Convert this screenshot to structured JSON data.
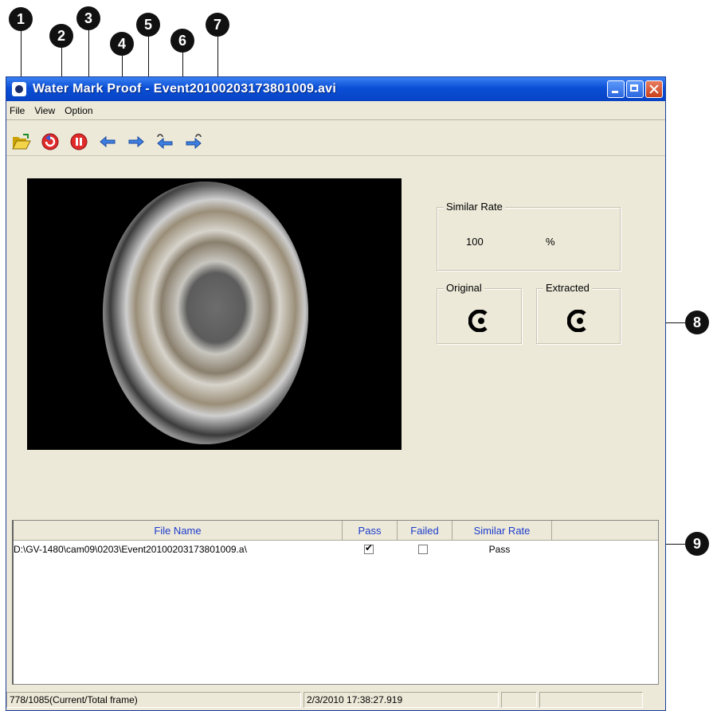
{
  "callouts": [
    "1",
    "2",
    "3",
    "4",
    "5",
    "6",
    "7",
    "8",
    "9"
  ],
  "window": {
    "title": "Water Mark Proof - Event20100203173801009.avi"
  },
  "menu": [
    "File",
    "View",
    "Option"
  ],
  "toolbar": {
    "icons": [
      "open-folder-icon",
      "rewind-icon",
      "pause-icon",
      "prev-frame-icon",
      "next-frame-icon",
      "prev-segment-icon",
      "next-segment-icon"
    ]
  },
  "similar_rate": {
    "label": "Similar Rate",
    "value": "100",
    "unit": "%"
  },
  "original": {
    "label": "Original"
  },
  "extracted": {
    "label": "Extracted"
  },
  "list": {
    "columns": [
      "File Name",
      "Pass",
      "Failed",
      "Similar Rate"
    ],
    "rows": [
      {
        "file": "D:\\GV-1480\\cam09\\0203\\Event20100203173801009.a\\",
        "pass": true,
        "failed": false,
        "rate": "Pass"
      }
    ]
  },
  "status": {
    "frames": "778/1085(Current/Total frame)",
    "timestamp": "2/3/2010 17:38:27.919"
  },
  "colors": {
    "titlebar": "#0a4fd6",
    "window_bg": "#ece9d8",
    "header_text": "#1d3bcc"
  }
}
